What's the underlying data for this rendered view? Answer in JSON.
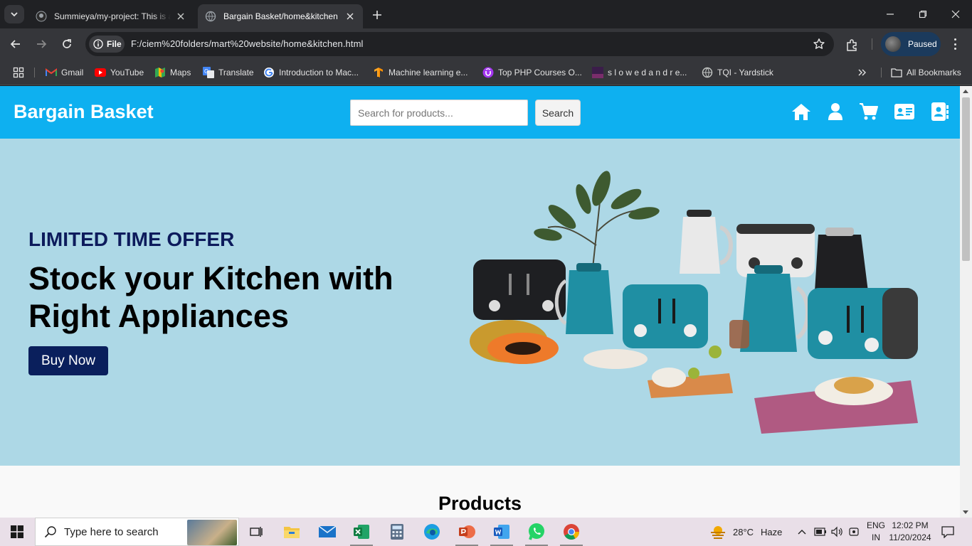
{
  "browser": {
    "tabs": [
      {
        "title": "Summieya/my-project: This is a",
        "active": false
      },
      {
        "title": "Bargain Basket/home&kitchen",
        "active": true
      }
    ],
    "address": {
      "scheme_chip": "File",
      "url": "F:/ciem%20folders/mart%20website/home&kitchen.html"
    },
    "profile_status": "Paused",
    "bookmarks": [
      {
        "label": "Gmail",
        "icon": "gmail-icon"
      },
      {
        "label": "YouTube",
        "icon": "youtube-icon"
      },
      {
        "label": "Maps",
        "icon": "maps-icon"
      },
      {
        "label": "Translate",
        "icon": "translate-icon"
      },
      {
        "label": "Introduction to Mac...",
        "icon": "google-icon"
      },
      {
        "label": "Machine learning e...",
        "icon": "tensorflow-icon"
      },
      {
        "label": "Top PHP Courses O...",
        "icon": "udemy-icon"
      },
      {
        "label": "s l o w e d a n d r e...",
        "icon": "music-icon"
      },
      {
        "label": "TQI - Yardstick",
        "icon": "globe-icon"
      }
    ],
    "all_bookmarks_label": "All Bookmarks"
  },
  "site": {
    "brand": "Bargain Basket",
    "search": {
      "placeholder": "Search for products...",
      "value": "",
      "button_label": "Search"
    },
    "nav_icons": [
      "home-icon",
      "user-icon",
      "cart-icon",
      "contact-card-icon",
      "address-book-icon"
    ],
    "hero": {
      "offer": "LIMITED TIME OFFER",
      "headline": "Stock your Kitchen with Right Appliances",
      "cta": "Buy Now"
    },
    "products_title": "Products"
  },
  "taskbar": {
    "search_placeholder": "Type here to search",
    "apps": [
      "task-view-icon",
      "file-explorer-icon",
      "mail-icon",
      "excel-icon",
      "calculator-icon",
      "edge-icon",
      "powerpoint-icon",
      "word-icon",
      "whatsapp-icon",
      "chrome-icon"
    ],
    "weather": {
      "temp": "28°C",
      "condition": "Haze"
    },
    "language": {
      "line1": "ENG",
      "line2": "IN"
    },
    "time": "12:02 PM",
    "date": "11/20/2024"
  },
  "colors": {
    "header_bg": "#0eb0f0",
    "hero_bg": "#add8e6",
    "offer_text": "#0d1b5c",
    "cta_bg": "#0a1f5c",
    "teal_appliance": "#1f8fa3"
  }
}
